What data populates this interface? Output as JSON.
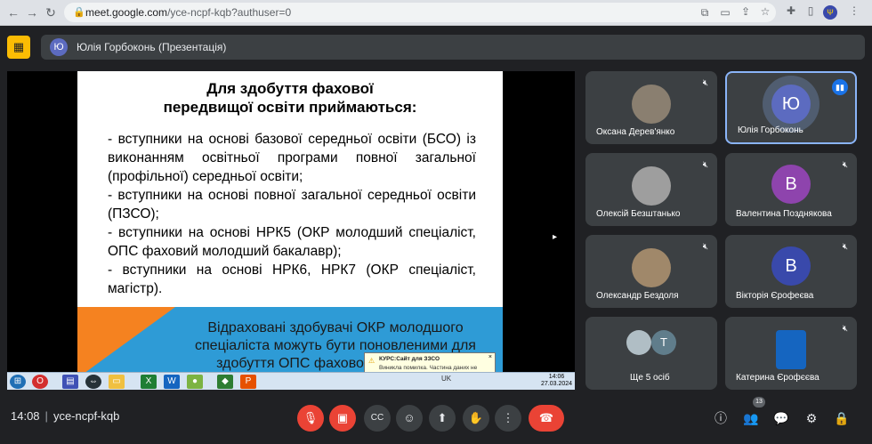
{
  "browser": {
    "url_host": "meet.google.com",
    "url_path": "/yce-ncpf-kqb?authuser=0"
  },
  "presenter": {
    "avatar_letter": "Ю",
    "label": "Юлія Горбоконь (Презентація)"
  },
  "slide": {
    "title_line1": "Для здобуття фахової",
    "title_line2": "передвищої освіти приймаються:",
    "items": [
      "-        вступники на основі базової середньої освіти (БСО) із виконанням освітньої програми повної загальної (профільної) середньої освіти;",
      "-        вступники на основі повної загальної середньої освіти (ПЗСО);",
      "-        вступники на основі НРК5 (ОКР молодший спеціаліст, ОПС фаховий молодший бакалавр);",
      "-        вступники на основі НРК6, НРК7 (ОКР спеціаліст, магістр)."
    ],
    "band_text": "Відраховані здобувачі ОКР молодшого спеціаліста можуть бути поновленими для здобуття ОПС фахового молодшого"
  },
  "windows": {
    "notification_title": "КУРС:Сайт для ЗЗСО",
    "notification_text": "Виникла помилка. Частина даних не завантажена.",
    "tray_lang": "UK",
    "clock_time": "14:06",
    "clock_date": "27.03.2024"
  },
  "participants": [
    {
      "name": "Оксана Дерев'янко"
    },
    {
      "name": "Юлія Горбоконь",
      "letter": "Ю"
    },
    {
      "name": "Олексій Безштанько"
    },
    {
      "name": "Валентина Позднякова",
      "letter": "В"
    },
    {
      "name": "Олександр Бездоля"
    },
    {
      "name": "Вікторія Єрофеєва",
      "letter": "В"
    },
    {
      "name": "Ще 5 осіб",
      "letter": "Т"
    },
    {
      "name": "Катерина Єрофєєва"
    }
  ],
  "colors": {
    "avatar_blue": "#5c6bc0",
    "avatar_purple": "#8e44ad",
    "avatar_indigo": "#3949ab",
    "avatar_grey": "#607d8b",
    "danger": "#ea4335"
  },
  "bottom": {
    "time": "14:08",
    "meeting_code": "yce-ncpf-kqb",
    "participant_count": "13"
  },
  "icons": {
    "mic_off": "🎙",
    "cam_off": "▣",
    "captions": "CC",
    "emoji": "☺",
    "present": "⬆",
    "hand": "✋",
    "more": "⋮",
    "end": "☎",
    "info": "ⓘ",
    "people": "👥",
    "chat": "💬",
    "activities": "⚙",
    "host": "🔒"
  }
}
